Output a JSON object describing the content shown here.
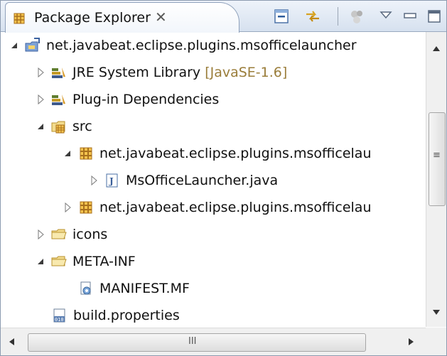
{
  "view": {
    "title": "Package Explorer",
    "close_glyph": "✕",
    "title_icon": "package-explorer-icon",
    "toolbar": [
      {
        "name": "collapse-all-icon",
        "tooltip": "Collapse All"
      },
      {
        "name": "link-with-editor-icon",
        "tooltip": "Link with Editor"
      },
      {
        "name": "focus-task-icon",
        "tooltip": "Focus on Active Task"
      },
      {
        "name": "view-menu-icon",
        "tooltip": "View Menu"
      },
      {
        "name": "minimize-icon",
        "tooltip": "Minimize"
      },
      {
        "name": "maximize-icon",
        "tooltip": "Maximize"
      }
    ]
  },
  "tree": [
    {
      "label": "net.javabeat.eclipse.plugins.msofficelauncher",
      "icon": "plugin-project-icon",
      "expanded": true
    },
    {
      "label": "JRE System Library",
      "decoration": "[JavaSE-1.6]",
      "icon": "library-icon",
      "expanded": false
    },
    {
      "label": "Plug-in Dependencies",
      "icon": "library-icon",
      "expanded": false
    },
    {
      "label": "src",
      "icon": "source-folder-icon",
      "expanded": true
    },
    {
      "label": "net.javabeat.eclipse.plugins.msofficelau",
      "icon": "package-icon",
      "expanded": true
    },
    {
      "label": "MsOfficeLauncher.java",
      "icon": "java-file-icon",
      "expanded": false
    },
    {
      "label": "net.javabeat.eclipse.plugins.msofficelau",
      "icon": "package-icon",
      "expanded": false
    },
    {
      "label": "icons",
      "icon": "folder-icon",
      "expanded": false
    },
    {
      "label": "META-INF",
      "icon": "folder-icon",
      "expanded": true
    },
    {
      "label": "MANIFEST.MF",
      "icon": "manifest-file-icon"
    },
    {
      "label": "build.properties",
      "icon": "properties-file-icon"
    }
  ],
  "scrollbars": {
    "vertical_grip": "≡",
    "horizontal_grip": "III"
  },
  "colors": {
    "decoration": "#9a7d3a",
    "border": "#8c9bb0"
  }
}
